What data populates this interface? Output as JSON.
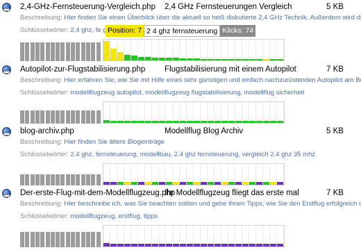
{
  "labels": {
    "description": "Beschreibung:",
    "keywords": "Schlüsselwörter:"
  },
  "colors": {
    "yellow": "#f5e600",
    "green": "#22c81e",
    "purple": "#6b2fc2",
    "gray": "#9c9c9c",
    "link": "#4a6fb0"
  },
  "tooltip": {
    "position": "Position: 7",
    "keyword": "2 4 ghz fernsteuerung",
    "clicks": "Klicks: 74"
  },
  "entries": [
    {
      "file": "2,4-GHz-Fernsteuerung-Vergleich.php",
      "title": "2,4 GHz Fernsteuerungen Vergleich",
      "size": "5 KB",
      "description": "Hier finden Sie einen Überblick über die aktuell so heiß diskutierte 2,4 GHz Technik. Außerdem wird die",
      "keywords": "2,4 ghz,   fe                                                           geru        vergleich 2,4 ghz 35 mhz",
      "gray_bars": [
        0.85,
        0.85,
        0.85,
        0.85,
        0.85,
        0.85,
        0.85,
        0.85,
        0.85,
        0.85,
        0.85,
        0.85,
        0.85,
        0.85,
        0.85,
        0.85
      ],
      "bars": [
        {
          "c": "yellow",
          "h": 0.92
        },
        {
          "c": "yellow",
          "h": 0.55
        },
        {
          "c": "yellow",
          "h": 0.4
        },
        {
          "c": "green",
          "h": 0.28
        },
        {
          "c": "green",
          "h": 0.22
        },
        {
          "c": "green",
          "h": 0.18
        },
        {
          "c": "green",
          "h": 0.16
        },
        {
          "c": "green",
          "h": 0.14
        },
        {
          "c": "green",
          "h": 0.14
        },
        {
          "c": "green",
          "h": 0.12
        },
        {
          "c": "green",
          "h": 0.12
        },
        {
          "c": "green",
          "h": 0.1
        },
        {
          "c": "green",
          "h": 0.1
        },
        {
          "c": "green",
          "h": 0.1
        },
        {
          "c": "green",
          "h": 0.08
        },
        {
          "c": "green",
          "h": 0.08
        },
        {
          "c": "green",
          "h": 0.08
        },
        {
          "c": "green",
          "h": 0.07
        },
        {
          "c": "green",
          "h": 0.07
        },
        {
          "c": "green",
          "h": 0.06
        },
        {
          "c": "green",
          "h": 0.06
        },
        {
          "c": "green",
          "h": 0.06
        },
        {
          "c": "green",
          "h": 0.05
        },
        {
          "c": "yellow",
          "h": 0.05
        },
        {
          "c": "green",
          "h": 0.05
        },
        {
          "c": "green",
          "h": 0.05
        }
      ]
    },
    {
      "file": "Autopilot-zur-Flugstabilisierung.php",
      "title": "Flugstabilisierung mit einem Autopilot",
      "size": "7 KB",
      "description": "Hier erfahren Sie, wie Sie mit Hilfe eines sehr günstigen und einfach nachzurüstenden Autopilot am Beisp",
      "keywords": "modellflugzeug autopilot,   modellflugzeug flugstabilisierung,   modellflug sicherheit",
      "gray_bars": [
        0.6,
        0.6,
        0.6,
        0.6,
        0.6,
        0.6,
        0.6,
        0.6,
        0.6,
        0.6,
        0.6,
        0.6,
        0.6,
        0.6,
        0.6,
        0.6
      ],
      "bars": [
        {
          "c": "green",
          "h": 0.12
        },
        {
          "c": "green",
          "h": 0.1
        },
        {
          "c": "green",
          "h": 0.1
        },
        {
          "c": "green",
          "h": 0.1
        },
        {
          "c": "green",
          "h": 0.1
        },
        {
          "c": "green",
          "h": 0.1
        },
        {
          "c": "green",
          "h": 0.1
        },
        {
          "c": "green",
          "h": 0.1
        },
        {
          "c": "green",
          "h": 0.1
        },
        {
          "c": "green",
          "h": 0.1
        },
        {
          "c": "green",
          "h": 0.1
        },
        {
          "c": "green",
          "h": 0.1
        },
        {
          "c": "green",
          "h": 0.1
        },
        {
          "c": "green",
          "h": 0.1
        },
        {
          "c": "green",
          "h": 0.1
        },
        {
          "c": "green",
          "h": 0.1
        },
        {
          "c": "green",
          "h": 0.1
        },
        {
          "c": "green",
          "h": 0.1
        },
        {
          "c": "green",
          "h": 0.1
        },
        {
          "c": "green",
          "h": 0.1
        },
        {
          "c": "green",
          "h": 0.1
        },
        {
          "c": "green",
          "h": 0.1
        },
        {
          "c": "green",
          "h": 0.1
        },
        {
          "c": "green",
          "h": 0.1
        },
        {
          "c": "green",
          "h": 0.1
        },
        {
          "c": "green",
          "h": 0.1
        }
      ]
    },
    {
      "file": "blog-archiv.php",
      "title": "Modellflug Blog Archiv",
      "size": "5 KB",
      "description": "Hier finden Sie ältere Blogeinträge",
      "keywords": "2.4 ghz,   fernsteuerung,   modellbau,   2.4 ghz fernsteuerung,   vergleich 2.4 ghz 35 mhz",
      "gray_bars": [
        0.5,
        0.5,
        0.5,
        0.5,
        0.5,
        0.5,
        0.5,
        0.5,
        0.5,
        0.5,
        0.5,
        0.5,
        0.5,
        0.5,
        0.5,
        0.5
      ],
      "bars": [
        {
          "c": "purple",
          "h": 0.12
        },
        {
          "c": "purple",
          "h": 0.12
        },
        {
          "c": "green",
          "h": 0.12
        },
        {
          "c": "yellow",
          "h": 0.12
        },
        {
          "c": "green",
          "h": 0.12
        },
        {
          "c": "purple",
          "h": 0.12
        },
        {
          "c": "yellow",
          "h": 0.12
        },
        {
          "c": "green",
          "h": 0.12
        },
        {
          "c": "purple",
          "h": 0.12
        },
        {
          "c": "green",
          "h": 0.12
        },
        {
          "c": "yellow",
          "h": 0.12
        },
        {
          "c": "purple",
          "h": 0.12
        },
        {
          "c": "green",
          "h": 0.12
        },
        {
          "c": "yellow",
          "h": 0.12
        },
        {
          "c": "purple",
          "h": 0.12
        },
        {
          "c": "green",
          "h": 0.12
        },
        {
          "c": "purple",
          "h": 0.12
        },
        {
          "c": "yellow",
          "h": 0.12
        },
        {
          "c": "green",
          "h": 0.12
        },
        {
          "c": "purple",
          "h": 0.12
        },
        {
          "c": "yellow",
          "h": 0.12
        },
        {
          "c": "green",
          "h": 0.12
        },
        {
          "c": "purple",
          "h": 0.12
        },
        {
          "c": "green",
          "h": 0.12
        },
        {
          "c": "yellow",
          "h": 0.12
        },
        {
          "c": "purple",
          "h": 0.12
        }
      ]
    },
    {
      "file": "Der-erste-Flug-mit-dem-Modellflugzeug.php",
      "title": "Ihr Modellflugzeug fliegt das erste mal",
      "size": "7 KB",
      "description": "Hier beschreibe ich, was Sie beachten sollten und gebe Ihnen Tipps, wie Sie den Erstflug erfolgreich üb",
      "keywords": "modellflugzeug,   erstflug,   tipps",
      "gray_bars": [
        0.7,
        0.7,
        0.7,
        0.7,
        0.7,
        0.7,
        0.7,
        0.7,
        0.7,
        0.7,
        0.7,
        0.7,
        0.7,
        0.7,
        0.7,
        0.7
      ],
      "bars": [
        {
          "c": "purple",
          "h": 0.15
        },
        {
          "c": "purple",
          "h": 0.12
        },
        {
          "c": "purple",
          "h": 0.12
        },
        {
          "c": "purple",
          "h": 0.12
        },
        {
          "c": "purple",
          "h": 0.12
        },
        {
          "c": "purple",
          "h": 0.12
        },
        {
          "c": "purple",
          "h": 0.12
        },
        {
          "c": "purple",
          "h": 0.12
        },
        {
          "c": "purple",
          "h": 0.12
        },
        {
          "c": "purple",
          "h": 0.12
        },
        {
          "c": "purple",
          "h": 0.12
        },
        {
          "c": "purple",
          "h": 0.12
        },
        {
          "c": "purple",
          "h": 0.12
        },
        {
          "c": "purple",
          "h": 0.12
        },
        {
          "c": "purple",
          "h": 0.12
        },
        {
          "c": "purple",
          "h": 0.12
        },
        {
          "c": "purple",
          "h": 0.12
        },
        {
          "c": "purple",
          "h": 0.12
        },
        {
          "c": "purple",
          "h": 0.12
        },
        {
          "c": "purple",
          "h": 0.12
        },
        {
          "c": "purple",
          "h": 0.12
        },
        {
          "c": "purple",
          "h": 0.12
        },
        {
          "c": "purple",
          "h": 0.12
        },
        {
          "c": "purple",
          "h": 0.12
        },
        {
          "c": "purple",
          "h": 0.12
        },
        {
          "c": "purple",
          "h": 0.12
        }
      ]
    }
  ]
}
